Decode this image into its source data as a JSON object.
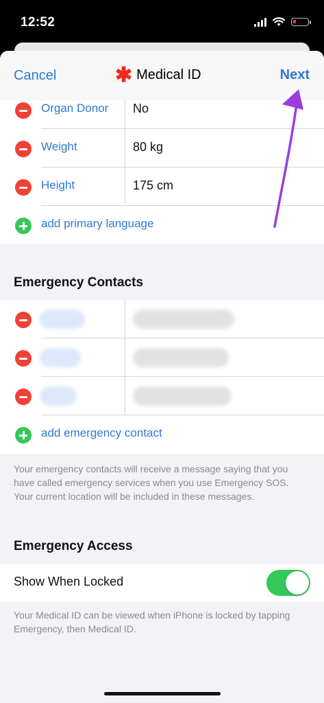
{
  "status_bar": {
    "time": "12:52",
    "icons": [
      "cellular-signal-icon",
      "wifi-icon",
      "battery-low-icon"
    ],
    "battery_color": "#ff3b30"
  },
  "nav": {
    "cancel": "Cancel",
    "title": "Medical ID",
    "title_icon": "medical-star-icon",
    "next": "Next"
  },
  "details": [
    {
      "label": "Organ Donor",
      "value": "No"
    },
    {
      "label": "Weight",
      "value": "80 kg"
    },
    {
      "label": "Height",
      "value": "175 cm"
    }
  ],
  "add_language": "add primary language",
  "emergency_contacts": {
    "header": "Emergency Contacts",
    "add_label": "add emergency contact",
    "footnote": "Your emergency contacts will receive a message saying that you have called emergency services when you use Emergency SOS. Your current location will be included in these messages."
  },
  "emergency_access": {
    "header": "Emergency Access",
    "show_when_locked_label": "Show When Locked",
    "show_when_locked_on": true,
    "footnote": "Your Medical ID can be viewed when iPhone is locked by tapping Emergency, then Medical ID."
  },
  "colors": {
    "accent": "#2d7ad6",
    "delete": "#f14036",
    "add": "#34c759",
    "toggle_on": "#34c759",
    "annotation_arrow": "#9b3ddb"
  }
}
